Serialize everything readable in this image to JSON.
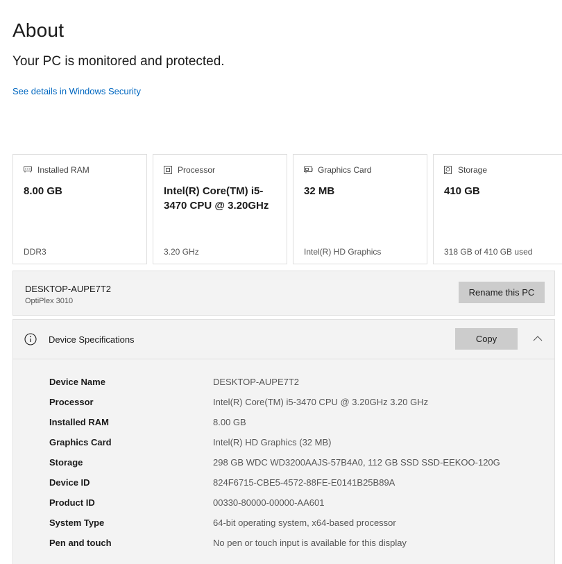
{
  "header": {
    "title": "About",
    "status": "Your PC is monitored and protected.",
    "security_link": "See details in Windows Security"
  },
  "cards": [
    {
      "icon": "ram-icon",
      "label": "Installed RAM",
      "value": "8.00 GB",
      "footer": "DDR3"
    },
    {
      "icon": "processor-icon",
      "label": "Processor",
      "value": "Intel(R) Core(TM) i5-3470 CPU @ 3.20GHz",
      "footer": "3.20 GHz"
    },
    {
      "icon": "graphics-card-icon",
      "label": "Graphics Card",
      "value": "32 MB",
      "footer": "Intel(R) HD Graphics"
    },
    {
      "icon": "storage-icon",
      "label": "Storage",
      "value": "410 GB",
      "footer": "318 GB of 410 GB used"
    }
  ],
  "pc": {
    "name": "DESKTOP-AUPE7T2",
    "model": "OptiPlex 3010",
    "rename_label": "Rename this PC"
  },
  "specs": {
    "title": "Device Specifications",
    "copy_label": "Copy",
    "rows": [
      {
        "label": "Device Name",
        "value": "DESKTOP-AUPE7T2"
      },
      {
        "label": "Processor",
        "value": "Intel(R) Core(TM) i5-3470 CPU @ 3.20GHz   3.20 GHz"
      },
      {
        "label": "Installed RAM",
        "value": "8.00 GB"
      },
      {
        "label": "Graphics Card",
        "value": "Intel(R) HD Graphics (32 MB)"
      },
      {
        "label": "Storage",
        "value": "298 GB WDC WD3200AAJS-57B4A0, 112 GB SSD SSD-EEKOO-120G"
      },
      {
        "label": "Device ID",
        "value": "824F6715-CBE5-4572-88FE-E0141B25B89A"
      },
      {
        "label": "Product ID",
        "value": "00330-80000-00000-AA601"
      },
      {
        "label": "System Type",
        "value": "64-bit operating system, x64-based processor"
      },
      {
        "label": "Pen and touch",
        "value": "No pen or touch input is available for this display"
      }
    ]
  },
  "colors": {
    "link": "#0067c0",
    "button_bg": "#cccccc",
    "panel_bg": "#f3f3f3"
  }
}
